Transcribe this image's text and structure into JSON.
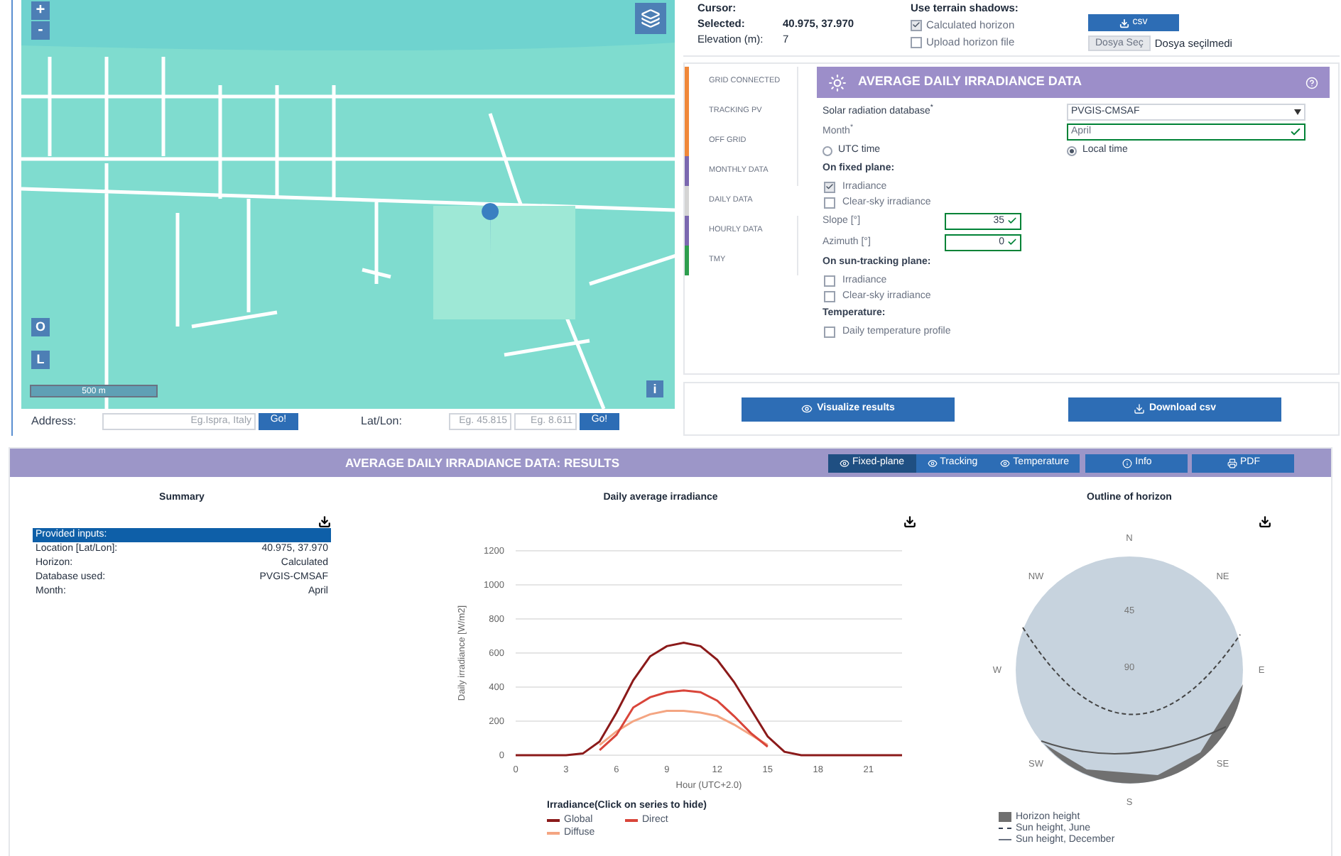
{
  "location_info": {
    "cursor_label": "Cursor:",
    "selected_label": "Selected:",
    "selected_value": "40.975, 37.970",
    "elevation_label": "Elevation (m):",
    "elevation_value": "7"
  },
  "terrain": {
    "title": "Use terrain shadows:",
    "options": [
      {
        "label": "Calculated horizon",
        "checked": true
      },
      {
        "label": "Upload horizon file",
        "checked": false
      }
    ],
    "csv_button": "csv",
    "file_button": "Dosya Seç",
    "file_status": "Dosya seçilmedi"
  },
  "map": {
    "zoom_in": "+",
    "zoom_out": "-",
    "button_o": "O",
    "button_l": "L",
    "scale": "500 m",
    "info": "i"
  },
  "search": {
    "address_label": "Address:",
    "address_placeholder": "Eg.Ispra, Italy",
    "address_go": "Go!",
    "latlon_label": "Lat/Lon:",
    "lat_placeholder": "Eg. 45.815",
    "lon_placeholder": "Eg. 8.611",
    "latlon_go": "Go!"
  },
  "sidebar_tabs": [
    {
      "label": "GRID CONNECTED",
      "color": "#f0883a",
      "selected": false
    },
    {
      "label": "TRACKING PV",
      "color": "#f0883a",
      "selected": false
    },
    {
      "label": "OFF GRID",
      "color": "#f0883a",
      "selected": false
    },
    {
      "label": "MONTHLY DATA",
      "color": "#7b68b0",
      "selected": false
    },
    {
      "label": "DAILY DATA",
      "color": "#d4d4d4",
      "selected": true
    },
    {
      "label": "HOURLY DATA",
      "color": "#7b68b0",
      "selected": false
    },
    {
      "label": "TMY",
      "color": "#2e9e4e",
      "selected": false
    }
  ],
  "form": {
    "title": "AVERAGE DAILY IRRADIANCE DATA",
    "database_label": "Solar radiation database$^{*}$",
    "database_value": "PVGIS-CMSAF",
    "month_label": "Month$^{*}$",
    "month_value": "April",
    "time_options": [
      {
        "label": "UTC time",
        "selected": false
      },
      {
        "label": "Local time",
        "selected": true
      }
    ],
    "sections": [
      {
        "title": "On fixed plane:",
        "options": [
          {
            "label": "Irradiance",
            "checked": true
          },
          {
            "label": "Clear-sky irradiance",
            "checked": false
          }
        ],
        "fields": [
          {
            "label": "Slope [°]",
            "value": "35"
          },
          {
            "label": "Azimuth [°]",
            "value": "0"
          }
        ]
      },
      {
        "title": "On sun-tracking plane:",
        "options": [
          {
            "label": "Irradiance",
            "checked": false
          },
          {
            "label": "Clear-sky irradiance",
            "checked": false
          }
        ]
      },
      {
        "title": "Temperature:",
        "options": [
          {
            "label": "Daily temperature profile",
            "checked": false
          }
        ]
      }
    ]
  },
  "actions": {
    "visualize": "Visualize results",
    "download": "Download csv"
  },
  "results": {
    "title": "AVERAGE DAILY IRRADIANCE DATA: RESULTS",
    "tabs": [
      {
        "label": "Fixed-plane",
        "selected": true
      },
      {
        "label": "Tracking",
        "selected": false
      },
      {
        "label": "Temperature",
        "selected": false
      }
    ],
    "info_button": "Info",
    "pdf_button": "PDF",
    "summary": {
      "title": "Summary",
      "header": "Provided inputs:",
      "rows": [
        {
          "label": "Location [Lat/Lon]:",
          "value": "40.975, 37.970"
        },
        {
          "label": "Horizon:",
          "value": "Calculated"
        },
        {
          "label": "Database used:",
          "value": "PVGIS-CMSAF"
        },
        {
          "label": "Month:",
          "value": "April"
        }
      ]
    },
    "irradiance": {
      "title": "Daily average irradiance",
      "legend_title": "Irradiance(Click on series to hide)",
      "chart_data": {
        "type": "line",
        "xlabel": "Hour (UTC+2.0)",
        "ylabel": "Daily irradiance [W/m2]",
        "x": [
          0,
          1,
          2,
          3,
          4,
          5,
          6,
          7,
          8,
          9,
          10,
          11,
          12,
          13,
          14,
          15,
          16,
          17,
          18,
          19,
          20,
          21,
          22,
          23
        ],
        "xticks": [
          0,
          3,
          6,
          9,
          12,
          15,
          18,
          21
        ],
        "yticks": [
          0,
          200,
          400,
          600,
          800,
          1000,
          1200
        ],
        "ylim": [
          0,
          1200
        ],
        "xlim": [
          0,
          23
        ],
        "grid": true,
        "legend": "bottom",
        "series": [
          {
            "name": "Global",
            "color": "#8b1a1a",
            "values": [
              0,
              0,
              0,
              0,
              10,
              80,
              250,
              440,
              580,
              640,
              660,
              640,
              560,
              430,
              270,
              110,
              20,
              0,
              0,
              0,
              0,
              0,
              0,
              0
            ]
          },
          {
            "name": "Direct",
            "color": "#d9453a",
            "values": [
              null,
              null,
              null,
              null,
              null,
              30,
              120,
              280,
              340,
              370,
              380,
              370,
              320,
              230,
              130,
              50,
              null,
              null,
              null,
              null,
              null,
              null,
              null,
              null
            ]
          },
          {
            "name": "Diffuse",
            "color": "#f4a582",
            "values": [
              null,
              null,
              null,
              null,
              null,
              60,
              140,
              200,
              240,
              260,
              260,
              250,
              230,
              180,
              120,
              60,
              null,
              null,
              null,
              null,
              null,
              null,
              null,
              null
            ]
          }
        ]
      }
    },
    "horizon": {
      "title": "Outline of horizon",
      "directions": [
        "N",
        "NE",
        "E",
        "SE",
        "S",
        "SW",
        "W",
        "NW"
      ],
      "rings": [
        "45",
        "90"
      ],
      "legend": [
        {
          "kind": "swatch",
          "label": "Horizon height"
        },
        {
          "kind": "dashed",
          "label": "Sun height, June"
        },
        {
          "kind": "solid",
          "label": "Sun height, December"
        }
      ]
    }
  }
}
